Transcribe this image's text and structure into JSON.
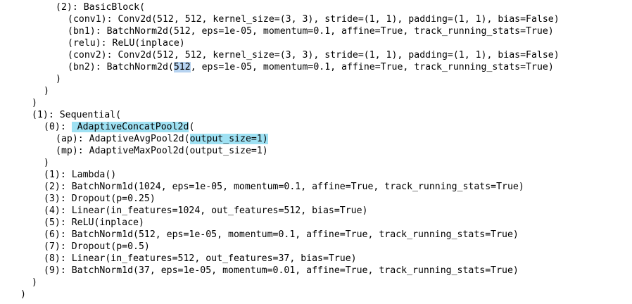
{
  "highlight_colors": {
    "selection": "#b7d3f0",
    "match": "#9fe1f3"
  },
  "lines": [
    {
      "indent": 3,
      "text": "(2): BasicBlock("
    },
    {
      "indent": 4,
      "text": "(conv1): Conv2d(512, 512, kernel_size=(3, 3), stride=(1, 1), padding=(1, 1), bias=False)"
    },
    {
      "indent": 4,
      "text": "(bn1): BatchNorm2d(512, eps=1e-05, momentum=0.1, affine=True, track_running_stats=True)"
    },
    {
      "indent": 4,
      "text": "(relu): ReLU(inplace)"
    },
    {
      "indent": 4,
      "text": "(conv2): Conv2d(512, 512, kernel_size=(3, 3), stride=(1, 1), padding=(1, 1), bias=False)"
    },
    {
      "indent": 4,
      "segments": [
        {
          "text": "(bn2): BatchNorm2d("
        },
        {
          "text": "512",
          "hl": "selection"
        },
        {
          "text": ", eps=1e-05, momentum=0.1, affine=True, track_running_stats=True)"
        }
      ]
    },
    {
      "indent": 3,
      "text": ")"
    },
    {
      "indent": 2,
      "text": ")"
    },
    {
      "indent": 1,
      "text": ")"
    },
    {
      "indent": 1,
      "text": "(1): Sequential("
    },
    {
      "indent": 2,
      "segments": [
        {
          "text": "(0): "
        },
        {
          "text": " AdaptiveConcatPool2d",
          "hl": "match"
        },
        {
          "text": "("
        }
      ]
    },
    {
      "indent": 3,
      "segments": [
        {
          "text": "(ap): AdaptiveAvgPool2d("
        },
        {
          "text": "output_size=1)",
          "hl": "match"
        }
      ]
    },
    {
      "indent": 3,
      "text": "(mp): AdaptiveMaxPool2d(output_size=1)"
    },
    {
      "indent": 2,
      "text": ")"
    },
    {
      "indent": 2,
      "text": "(1): Lambda()"
    },
    {
      "indent": 2,
      "text": "(2): BatchNorm1d(1024, eps=1e-05, momentum=0.1, affine=True, track_running_stats=True)"
    },
    {
      "indent": 2,
      "text": "(3): Dropout(p=0.25)"
    },
    {
      "indent": 2,
      "text": "(4): Linear(in_features=1024, out_features=512, bias=True)"
    },
    {
      "indent": 2,
      "text": "(5): ReLU(inplace)"
    },
    {
      "indent": 2,
      "text": "(6): BatchNorm1d(512, eps=1e-05, momentum=0.1, affine=True, track_running_stats=True)"
    },
    {
      "indent": 2,
      "text": "(7): Dropout(p=0.5)"
    },
    {
      "indent": 2,
      "text": "(8): Linear(in_features=512, out_features=37, bias=True)"
    },
    {
      "indent": 2,
      "text": "(9): BatchNorm1d(37, eps=1e-05, momentum=0.01, affine=True, track_running_stats=True)"
    },
    {
      "indent": 1,
      "text": ")"
    },
    {
      "indent": 0,
      "text": ")"
    }
  ]
}
